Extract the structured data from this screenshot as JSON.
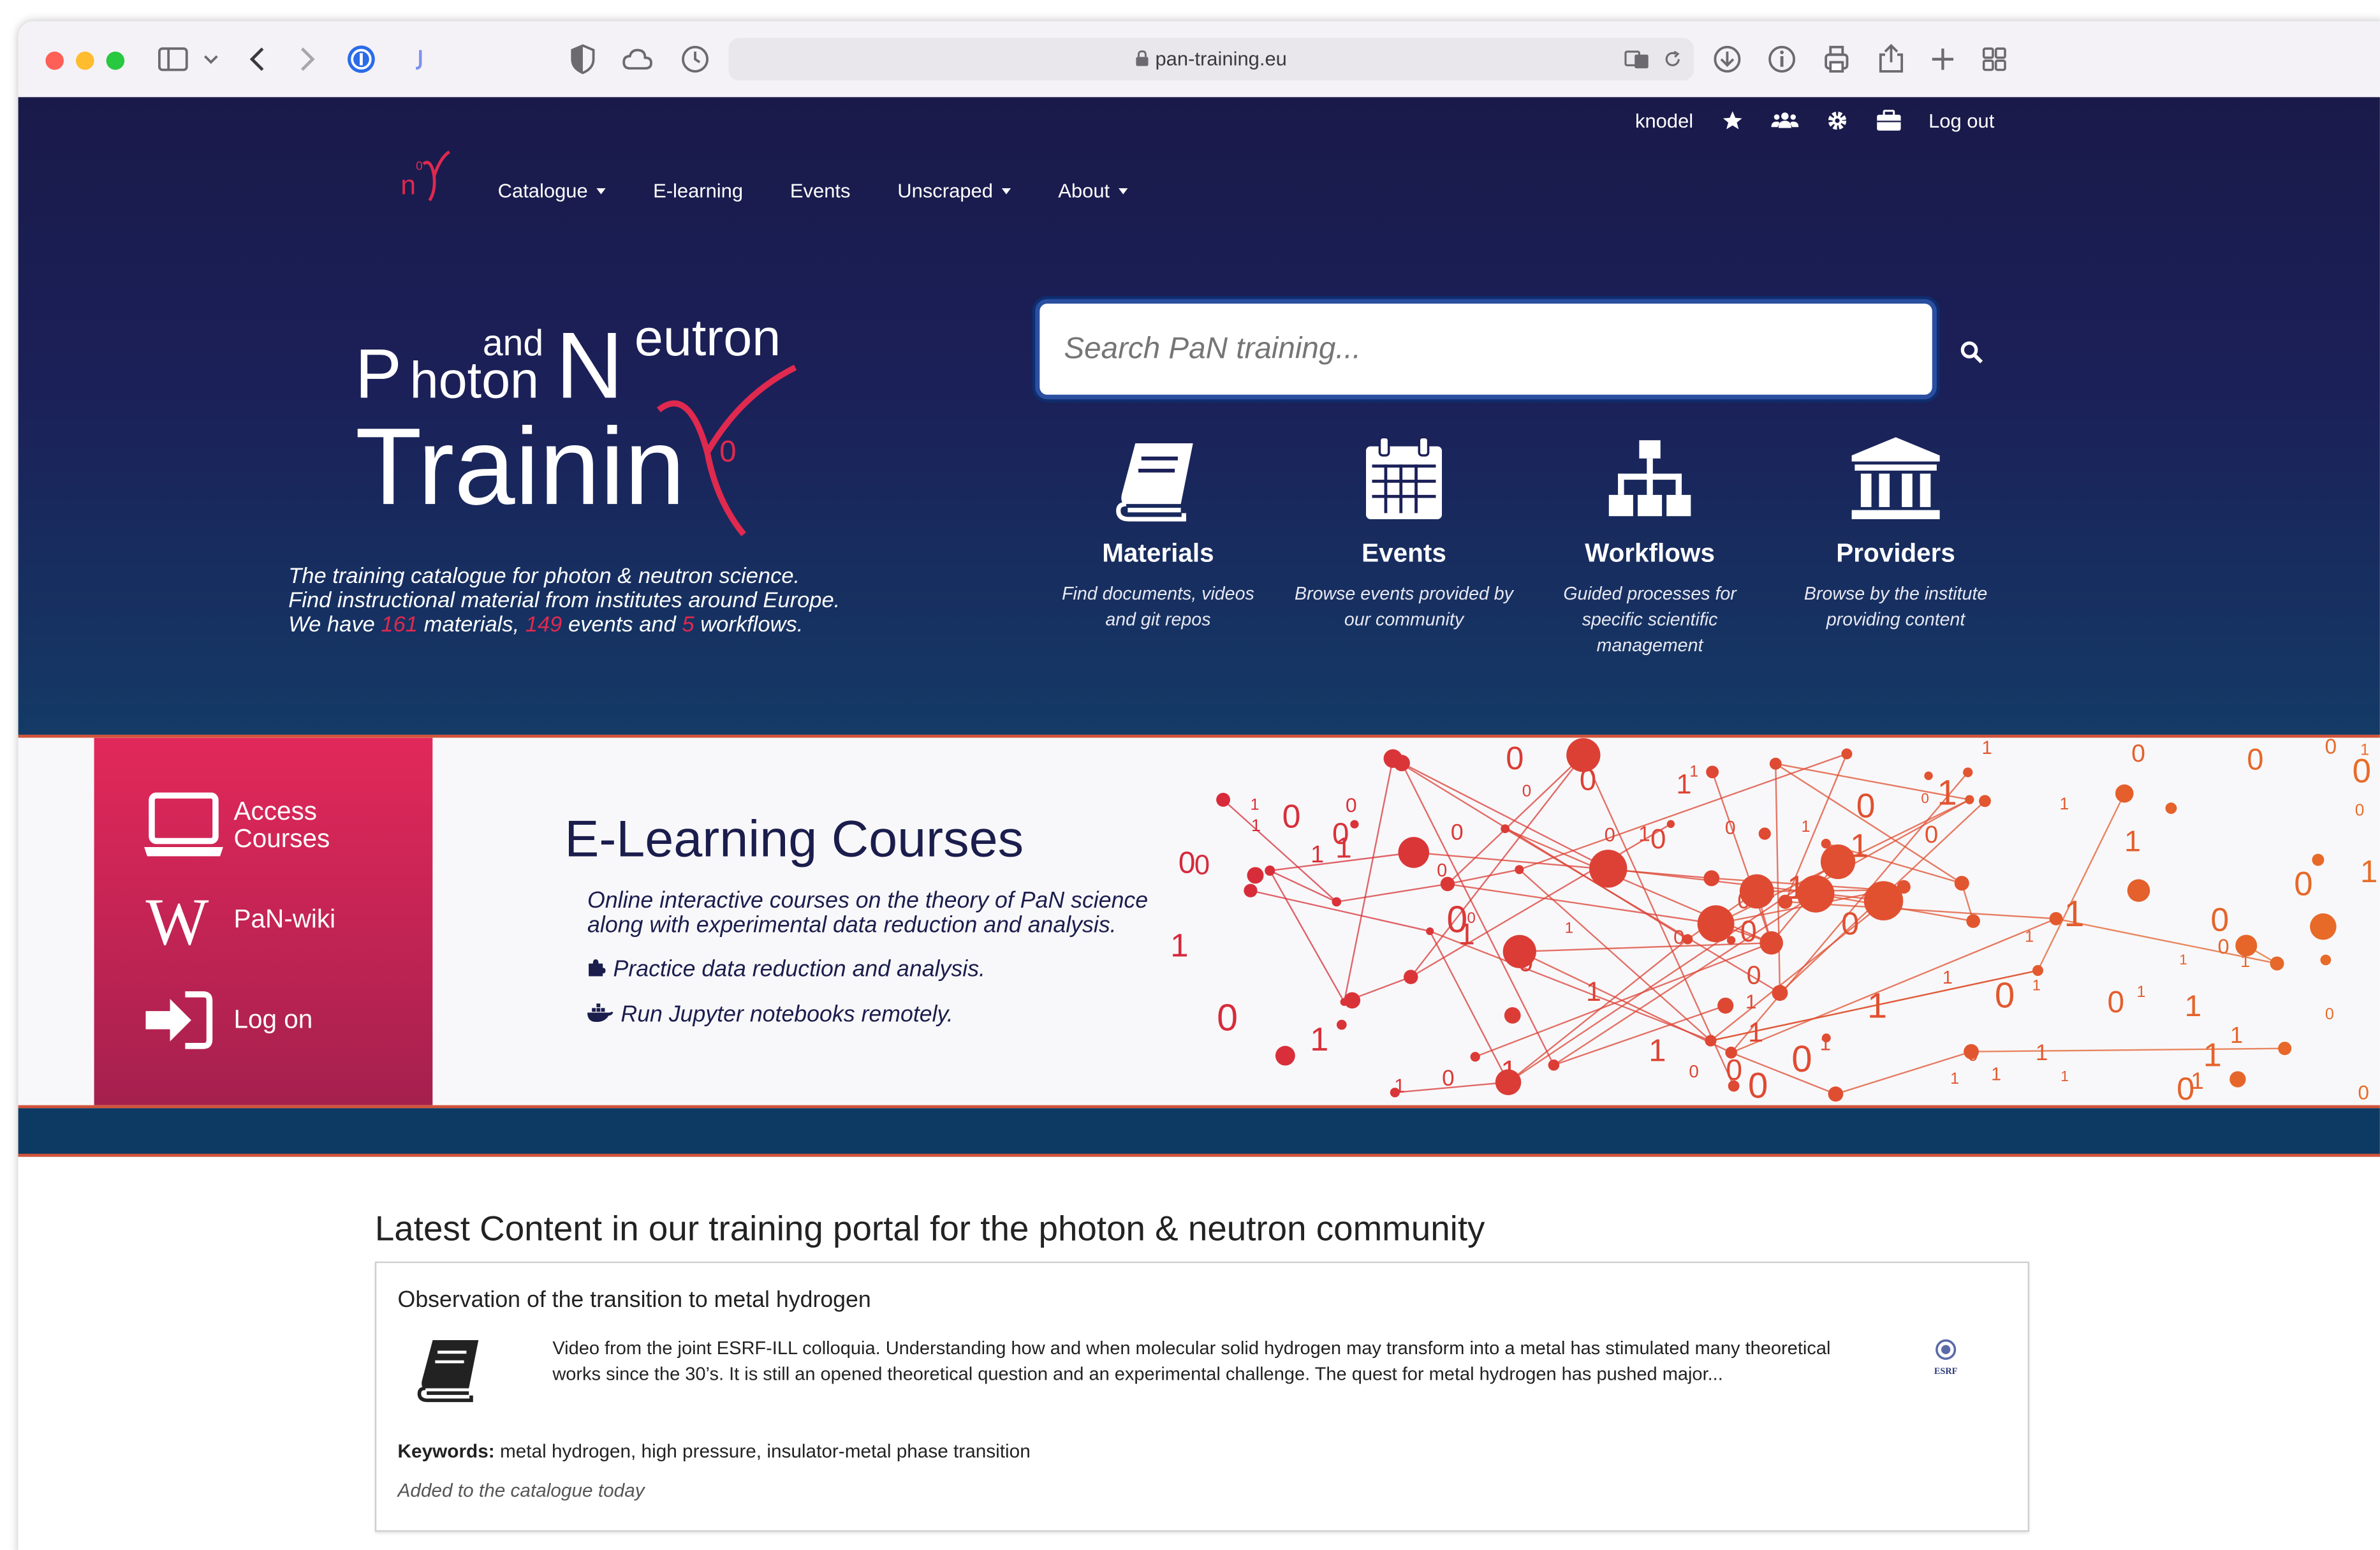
{
  "browser": {
    "url": "pan-training.eu"
  },
  "site": {
    "user": {
      "name": "knodel",
      "logout_label": "Log out"
    },
    "nav": [
      {
        "label": "Catalogue",
        "dropdown": true
      },
      {
        "label": "E-learning",
        "dropdown": false
      },
      {
        "label": "Events",
        "dropdown": false
      },
      {
        "label": "Unscraped",
        "dropdown": true
      },
      {
        "label": "About",
        "dropdown": true
      }
    ],
    "logo": {
      "line1a": "P",
      "line1b": "hoton",
      "line1c": "and",
      "line1d": "N",
      "line1e": "eutron",
      "line2": "Trainin",
      "superscript": "0"
    },
    "tagline": {
      "line1": "The training catalogue for photon & neutron science.",
      "line2": "Find instructional material from institutes around Europe.",
      "prefix": "We have ",
      "materials_count": "161",
      "materials_word": " materials, ",
      "events_count": "149",
      "events_word": " events and ",
      "workflows_count": "5",
      "workflows_word": " workflows."
    },
    "search": {
      "placeholder": "Search PaN training..."
    },
    "features": [
      {
        "title": "Materials",
        "desc": "Find documents, videos and git repos",
        "icon": "book-icon"
      },
      {
        "title": "Events",
        "desc": "Browse events provided by our community",
        "icon": "calendar-icon"
      },
      {
        "title": "Workflows",
        "desc": "Guided processes for specific scientific management",
        "icon": "sitemap-icon"
      },
      {
        "title": "Providers",
        "desc": "Browse by the institute providing content",
        "icon": "institution-icon"
      }
    ],
    "elearning": {
      "sidebar": [
        {
          "label": "Access Courses",
          "icon": "laptop-icon"
        },
        {
          "label": "PaN-wiki",
          "icon": "wikipedia-icon"
        },
        {
          "label": "Log on",
          "icon": "sign-in-icon"
        }
      ],
      "title": "E-Learning Courses",
      "intro_line1": "Online interactive courses on the theory of PaN science",
      "intro_line2": "along with experimental data reduction and analysis.",
      "bullet1": "Practice data reduction and analysis.",
      "bullet2": "Run Jupyter notebooks remotely."
    },
    "latest": {
      "heading": "Latest Content in our training portal for the photon & neutron community",
      "item": {
        "title": "Observation of the transition to metal hydrogen",
        "description": "Video from the joint ESRF-ILL colloquia. Understanding how and when molecular solid hydrogen may transform into a metal has stimulated many theoretical works since the 30’s. It is still an opened theoretical question and an experimental challenge. The quest for metal hydrogen has pushed major...",
        "keywords_label": "Keywords:",
        "keywords": "metal hydrogen, high pressure, insulator-metal phase transition",
        "added": "Added to the catalogue today",
        "provider_logo_text": "ESRF"
      }
    }
  },
  "colors": {
    "hero_top": "#1a1a4a",
    "hero_bottom": "#143a66",
    "accent": "#e0294f",
    "orange": "#d2543a",
    "navy_bar": "#0c3a63"
  }
}
